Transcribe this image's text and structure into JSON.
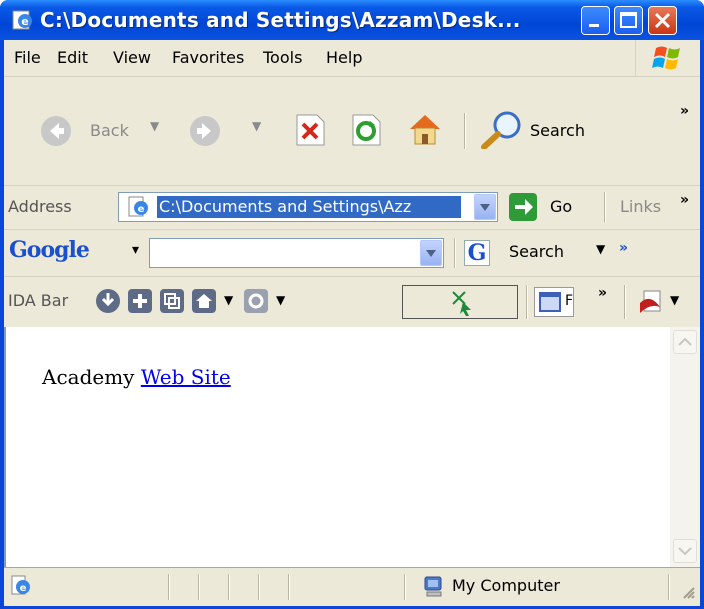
{
  "window": {
    "title": "C:\\Documents and Settings\\Azzam\\Desk...",
    "buttons": [
      "minimize",
      "maximize",
      "close"
    ]
  },
  "menubar": {
    "items": [
      "File",
      "Edit",
      "View",
      "Favorites",
      "Tools",
      "Help"
    ]
  },
  "toolbar": {
    "back_label": "Back",
    "search_label": "Search",
    "overflow": "»"
  },
  "address": {
    "label": "Address",
    "value": "C:\\Documents and Settings\\Azz",
    "go_label": "Go",
    "links_label": "Links",
    "overflow": "»"
  },
  "google": {
    "logo": "Google",
    "search_value": "",
    "search_label": "Search",
    "overflow": "»"
  },
  "idabar": {
    "label": "IDA Bar",
    "overflow": "»",
    "tab_text": "F"
  },
  "content": {
    "text": "Academy",
    "link": "Web Site"
  },
  "statusbar": {
    "zone": "My Computer"
  },
  "colors": {
    "titlebar": "#0a46d8",
    "chrome": "#ece9d8",
    "selection": "#316ac5",
    "link": "#0000ee"
  }
}
